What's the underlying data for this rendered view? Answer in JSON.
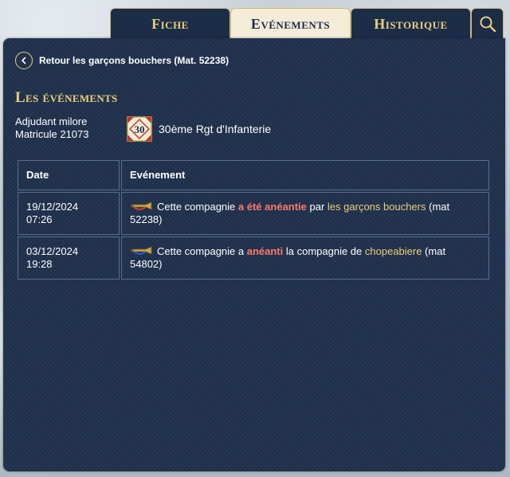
{
  "tabs": [
    {
      "label": "Fiche",
      "active": false
    },
    {
      "label": "Evénements",
      "active": true
    },
    {
      "label": "Historique",
      "active": false
    }
  ],
  "search_icon": "search-icon",
  "back_link": {
    "label": "Retour les garçons bouchers (Mat. 52238)",
    "icon": "chevron-left-icon"
  },
  "section_title": "Les événements",
  "soldier": {
    "rank_name": "Adjudant milore",
    "matricule": "Matricule 21073"
  },
  "regiment": {
    "badge_number": "30",
    "name": "30ème Rgt d'Infanterie"
  },
  "table": {
    "headers": [
      "Date",
      "Evénement"
    ],
    "rows": [
      {
        "date": "19/12/2024",
        "time": "07:26",
        "icon": "red-bugle-icon",
        "text_1": "Cette compagnie ",
        "highlight_1": "a été anéantie",
        "text_2": " par ",
        "highlight_2": "les garçons bouchers",
        "text_3": " (mat 52238)"
      },
      {
        "date": "03/12/2024",
        "time": "19:28",
        "icon": "blue-bugle-icon",
        "text_1": "Cette compagnie a ",
        "highlight_1": "anéanti",
        "text_2": " la compagnie de ",
        "highlight_2": "chopeabiere",
        "text_3": " (mat 54802)"
      }
    ]
  },
  "colors": {
    "panel": "#1f304c",
    "gold": "#e9cf7a",
    "red_highlight": "#ff7a6b",
    "active_tab": "#f4ecd8"
  }
}
